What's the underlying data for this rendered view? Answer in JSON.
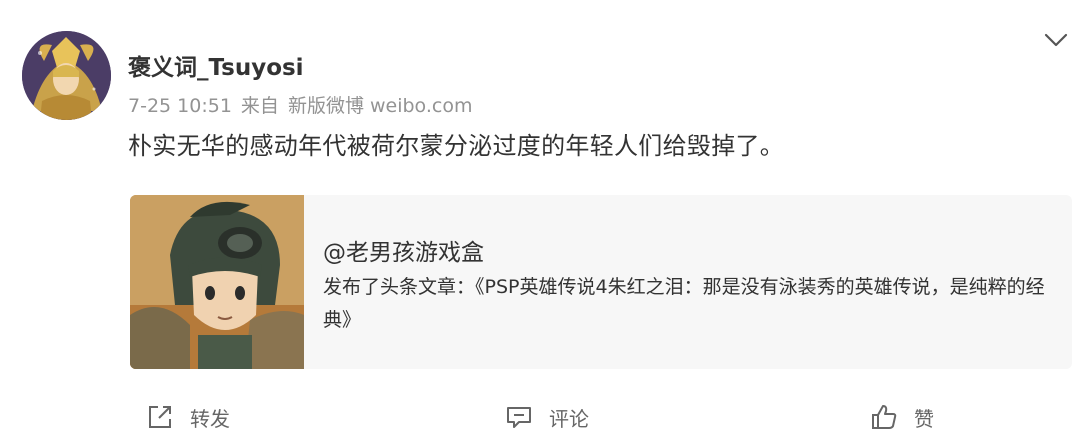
{
  "post": {
    "author_name": "褒义词_Tsuyosi",
    "timestamp": "7-25 10:51",
    "source_prefix": "来自",
    "source": "新版微博 weibo.com",
    "text": "朴实无华的感动年代被荷尔蒙分泌过度的年轻人们给毁掉了。",
    "menu_icon": "chevron-down-icon"
  },
  "repost_card": {
    "author": "@老男孩游戏盒",
    "description": "发布了头条文章：《PSP英雄传说4朱红之泪：那是没有泳装秀的英雄传说，是纯粹的经典》"
  },
  "actions": {
    "repost_label": "转发",
    "comment_label": "评论",
    "like_label": "赞",
    "repost_icon": "share-icon",
    "comment_icon": "comment-icon",
    "like_icon": "thumbs-up-icon"
  },
  "colors": {
    "name": "#333333",
    "meta": "#939393",
    "card_background": "#f7f7f7",
    "action_text": "#666666"
  }
}
